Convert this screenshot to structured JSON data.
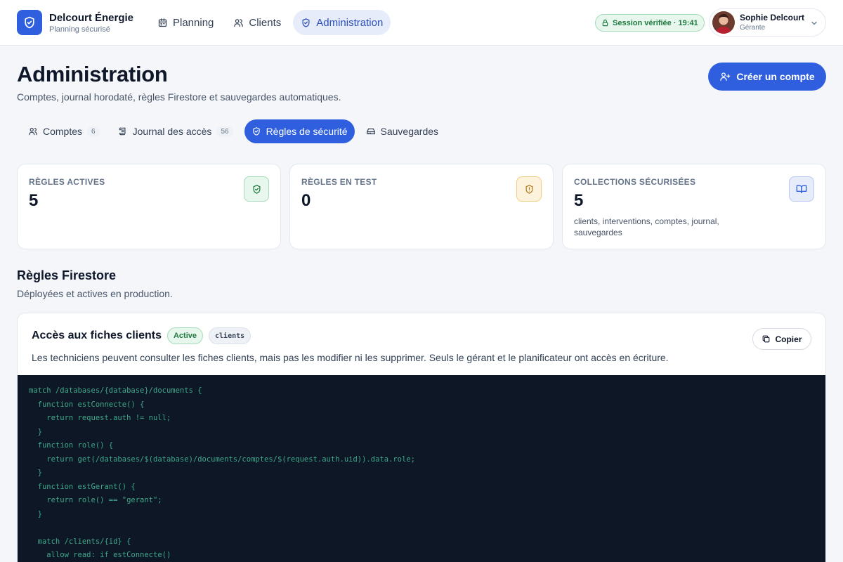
{
  "brand": {
    "name": "Delcourt Énergie",
    "subtitle": "Planning sécurisé"
  },
  "nav": [
    {
      "label": "Planning",
      "icon": "calendar-icon",
      "active": false
    },
    {
      "label": "Clients",
      "icon": "users-icon",
      "active": false
    },
    {
      "label": "Administration",
      "icon": "shield-icon",
      "active": true
    }
  ],
  "session": {
    "label": "Session vérifiée · 19:41"
  },
  "user": {
    "name": "Sophie Delcourt",
    "role": "Gérante"
  },
  "page": {
    "title": "Administration",
    "subtitle": "Comptes, journal horodaté, règles Firestore et sauvegardes automatiques.",
    "create_label": "Créer un compte"
  },
  "tabs": [
    {
      "label": "Comptes",
      "count": "6",
      "active": false
    },
    {
      "label": "Journal des accès",
      "count": "56",
      "active": false
    },
    {
      "label": "Règles de sécurité",
      "count": "",
      "active": true
    },
    {
      "label": "Sauvegardes",
      "count": "",
      "active": false
    }
  ],
  "stats": [
    {
      "label": "RÈGLES ACTIVES",
      "value": "5",
      "desc": "",
      "icon": "shield-check-icon",
      "tone": "#1f7a3f"
    },
    {
      "label": "RÈGLES EN TEST",
      "value": "0",
      "desc": "",
      "icon": "shield-alert-icon",
      "tone": "#b7791f"
    },
    {
      "label": "COLLECTIONS SÉCURISÉES",
      "value": "5",
      "desc": "clients, interventions, comptes, journal, sauvegardes",
      "icon": "book-open-icon",
      "tone": "#2f5fde"
    }
  ],
  "section": {
    "title": "Règles Firestore",
    "subtitle": "Déployées et actives en production."
  },
  "rule": {
    "title": "Accès aux fiches clients",
    "status": "Active",
    "collection": "clients",
    "description": "Les techniciens peuvent consulter les fiches clients, mais pas les modifier ni les supprimer. Seuls le gérant et le planificateur ont accès en écriture.",
    "copy_label": "Copier",
    "code": [
      "match /databases/{database}/documents {",
      "  function estConnecte() {",
      "    return request.auth != null;",
      "  }",
      "  function role() {",
      "    return get(/databases/$(database)/documents/comptes/$(request.auth.uid)).data.role;",
      "  }",
      "  function estGerant() {",
      "    return role() == \"gerant\";",
      "  }",
      "",
      "  match /clients/{id} {",
      "    allow read: if estConnecte()"
    ]
  },
  "colors": {
    "accent": "#2f5fde",
    "success": "#1f7a3f",
    "warning": "#b7791f",
    "code_bg": "#0d1726",
    "code_text": "#3fa98a"
  }
}
